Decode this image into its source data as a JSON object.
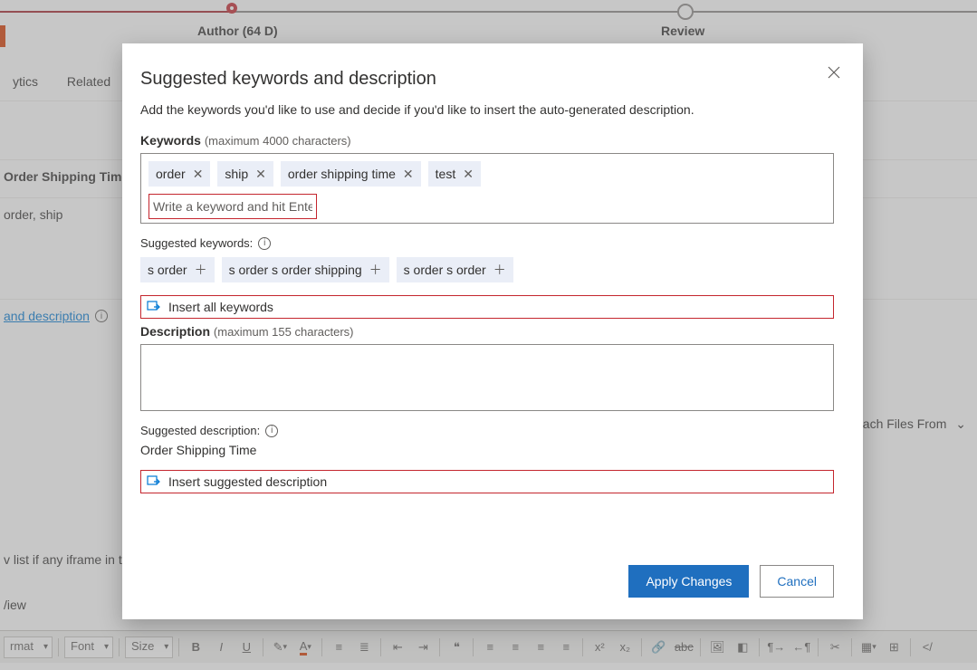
{
  "steps": {
    "author_label": "Author  (64 D)",
    "review_label": "Review"
  },
  "bg": {
    "tabs": {
      "analytics": "ytics",
      "related": "Related"
    },
    "field_title": "Order Shipping Time",
    "field_keywords": "order, ship",
    "link_and_desc": " and description",
    "attach_files": "ach Files From",
    "iframe_note": "v list if any iframe in t",
    "view_text": "/iew"
  },
  "toolbar_bottom": {
    "format": "rmat",
    "font": "Font",
    "size": "Size"
  },
  "modal": {
    "title": "Suggested keywords and description",
    "subtitle": "Add the keywords you'd like to use and decide if you'd like to insert the auto-generated description.",
    "keywords_label": "Keywords",
    "keywords_hint": "(maximum 4000 characters)",
    "keywords": [
      "order",
      "ship",
      "order shipping time",
      "test"
    ],
    "kw_input_placeholder": "Write a keyword and hit Enter",
    "suggested_keywords_label": "Suggested keywords:",
    "suggested_keywords": [
      "s order",
      "s order s order shipping",
      "s order s order"
    ],
    "insert_all_keywords": "Insert all keywords",
    "description_label": "Description",
    "description_hint": "(maximum 155 characters)",
    "suggested_description_label": "Suggested description:",
    "suggested_description": "Order Shipping Time",
    "insert_suggested_description": "Insert suggested description",
    "apply": "Apply Changes",
    "cancel": "Cancel"
  }
}
